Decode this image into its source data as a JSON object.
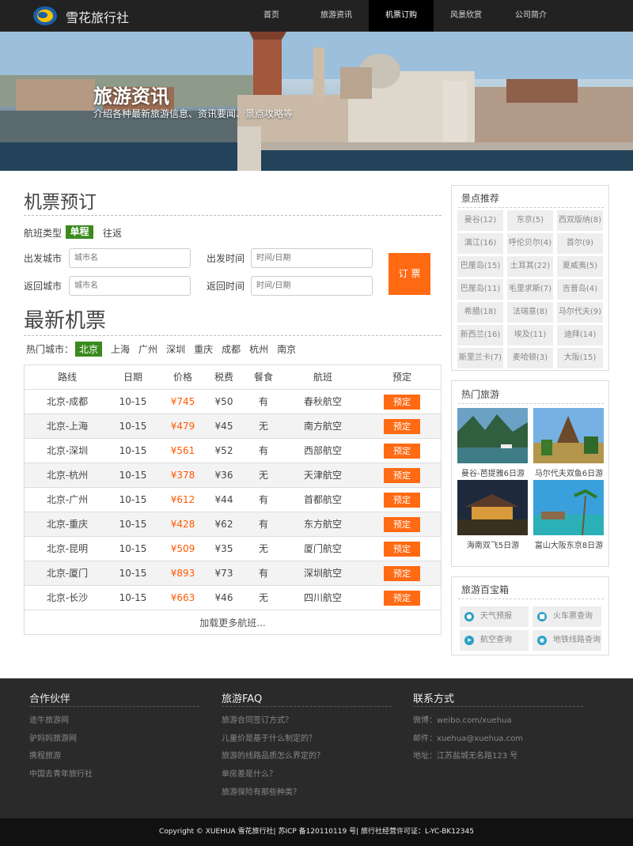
{
  "header": {
    "logo_text": "雪花旅行社",
    "nav": [
      "首页",
      "旅游资讯",
      "机票订购",
      "风景欣赏",
      "公司简介"
    ],
    "active_nav": "机票订购"
  },
  "hero": {
    "title": "旅游资讯",
    "subtitle": "介绍各种最新旅游信息、资讯要闻、景点攻略等"
  },
  "booking": {
    "title": "机票预订",
    "flight_type_label": "航班类型",
    "one_way": "单程",
    "round_trip": "往返",
    "depart_city_label": "出发城市",
    "depart_city_placeholder": "城市名",
    "depart_time_label": "出发时间",
    "depart_time_placeholder": "时间/日期",
    "return_city_label": "返回城市",
    "return_city_placeholder": "城市名",
    "return_time_label": "返回时间",
    "return_time_placeholder": "时间/日期",
    "submit": "订 票"
  },
  "tickets": {
    "title": "最新机票",
    "hot_cities_label": "热门城市：",
    "cities": [
      "北京",
      "上海",
      "广州",
      "深圳",
      "重庆",
      "成都",
      "杭州",
      "南京"
    ],
    "active_city": "北京",
    "columns": [
      "路线",
      "日期",
      "价格",
      "税费",
      "餐食",
      "航班",
      "预定"
    ],
    "rows": [
      {
        "route": "北京-成都",
        "date": "10-15",
        "price": "¥745",
        "tax": "¥50",
        "meal": "有",
        "airline": "春秋航空",
        "action": "预定"
      },
      {
        "route": "北京-上海",
        "date": "10-15",
        "price": "¥479",
        "tax": "¥45",
        "meal": "无",
        "airline": "南方航空",
        "action": "预定"
      },
      {
        "route": "北京-深圳",
        "date": "10-15",
        "price": "¥561",
        "tax": "¥52",
        "meal": "有",
        "airline": "西部航空",
        "action": "预定"
      },
      {
        "route": "北京-杭州",
        "date": "10-15",
        "price": "¥378",
        "tax": "¥36",
        "meal": "无",
        "airline": "天津航空",
        "action": "预定"
      },
      {
        "route": "北京-广州",
        "date": "10-15",
        "price": "¥612",
        "tax": "¥44",
        "meal": "有",
        "airline": "首都航空",
        "action": "预定"
      },
      {
        "route": "北京-重庆",
        "date": "10-15",
        "price": "¥428",
        "tax": "¥62",
        "meal": "有",
        "airline": "东方航空",
        "action": "预定"
      },
      {
        "route": "北京-昆明",
        "date": "10-15",
        "price": "¥509",
        "tax": "¥35",
        "meal": "无",
        "airline": "厦门航空",
        "action": "预定"
      },
      {
        "route": "北京-厦门",
        "date": "10-15",
        "price": "¥893",
        "tax": "¥73",
        "meal": "有",
        "airline": "深圳航空",
        "action": "预定"
      },
      {
        "route": "北京-长沙",
        "date": "10-15",
        "price": "¥663",
        "tax": "¥46",
        "meal": "无",
        "airline": "四川航空",
        "action": "预定"
      }
    ],
    "load_more": "加载更多航班..."
  },
  "sidebar": {
    "spots": {
      "title": "景点推荐",
      "tags": [
        "曼谷(12)",
        "东京(5)",
        "西双版纳(8)",
        "漓江(16)",
        "呼伦贝尔(4)",
        "首尔(9)",
        "巴厘岛(15)",
        "土耳其(22)",
        "夏威夷(5)",
        "巴厘岛(11)",
        "毛里求斯(7)",
        "吉普岛(4)",
        "希腊(18)",
        "法瑞意(8)",
        "马尔代夫(9)",
        "新西兰(16)",
        "埃及(11)",
        "迪拜(14)",
        "斯里兰卡(7)",
        "麦哈顿(3)",
        "大阪(15)"
      ]
    },
    "hot": {
      "title": "热门旅游",
      "items": [
        "曼谷-芭提雅6日游",
        "马尔代夫双鱼6日游",
        "海南双飞5日游",
        "富山大阪东京8日游"
      ]
    },
    "tools": {
      "title": "旅游百宝箱",
      "items": [
        "天气预报",
        "火车票查询",
        "航空查询",
        "地铁线路查询"
      ]
    }
  },
  "footer": {
    "partners": {
      "title": "合作伙伴",
      "links": [
        "途牛旅游网",
        "驴妈妈旅游网",
        "携程旅游",
        "中国去青年旅行社"
      ]
    },
    "faq": {
      "title": "旅游FAQ",
      "links": [
        "旅游合同签订方式？",
        "儿童价是基于什么制定的？",
        "旅游的线路品质怎么界定的？",
        "单房差是什么？",
        "旅游保险有那些种类？"
      ]
    },
    "contact": {
      "title": "联系方式",
      "lines": [
        "微博：weibo.com/xuehua",
        "邮件：xuehua@xuehua.com",
        "地址：江苏盐城无名路123 号"
      ]
    },
    "copyright": "Copyright © XUEHUA 雪花旅行社| 苏ICP 备120110119 号| 旅行社经营许可证：L-YC-BK12345"
  },
  "colors": {
    "accent": "#ff6a13",
    "green": "#3a8a1e",
    "header_bg": "#222222",
    "footer_bg": "#2a2a2a"
  }
}
